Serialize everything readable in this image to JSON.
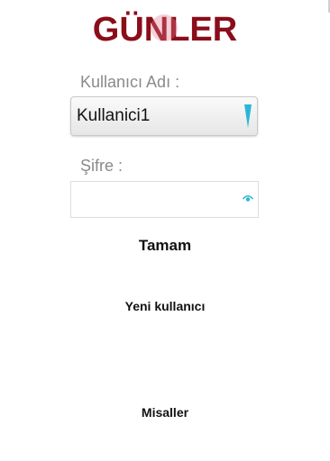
{
  "app": {
    "title": "GÜNLER"
  },
  "login": {
    "username_label": "Kullanıcı Adı :",
    "username_selected": "Kullanici1",
    "password_label": "Şifre :",
    "password_value": "",
    "password_placeholder": ""
  },
  "buttons": {
    "ok": "Tamam",
    "new_user": "Yeni kullanıcı",
    "examples": "Misaller"
  },
  "icons": {
    "dropdown": "dropdown-arrow-icon",
    "password_toggle": "eye-icon"
  },
  "colors": {
    "title": "#8b0d1a",
    "accent": "#29b6d8"
  }
}
